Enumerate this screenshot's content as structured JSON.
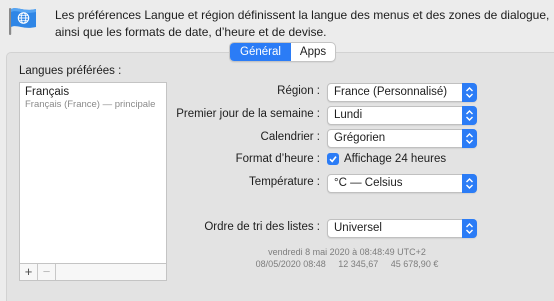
{
  "description": "Les préférences Langue et région définissent la langue des menus et des zones de dialogue, ainsi que les formats de date, d’heure et de devise.",
  "tabs": [
    {
      "label": "Général",
      "active": true
    },
    {
      "label": "Apps",
      "active": false
    }
  ],
  "languages": {
    "title": "Langues préférées :",
    "items": [
      {
        "name": "Français",
        "detail": "Français (France) — principale"
      }
    ],
    "add_label": "+",
    "remove_label": "−"
  },
  "settings": {
    "region": {
      "label": "Région :",
      "value": "France (Personnalisé)"
    },
    "first_day": {
      "label": "Premier jour de la semaine :",
      "value": "Lundi"
    },
    "calendar": {
      "label": "Calendrier :",
      "value": "Grégorien"
    },
    "time_format": {
      "label": "Format d’heure :",
      "checkbox_label": "Affichage 24 heures",
      "checked": true
    },
    "temperature": {
      "label": "Température :",
      "value": "°C — Celsius"
    },
    "sort_order": {
      "label": "Ordre de tri des listes :",
      "value": "Universel"
    }
  },
  "samples": {
    "line1": "vendredi 8 mai 2020 à 08:48:49 UTC+2",
    "line2": "08/05/2020 08:48     12 345,67     45 678,90 €"
  },
  "colors": {
    "accent": "#2b7cf6",
    "background": "#ececec",
    "panel": "#e3e3e3"
  },
  "icons": {
    "app_icon": "flag-globe-icon",
    "popup_arrow": "up-down-chevron-icon",
    "check": "checkmark-icon"
  }
}
